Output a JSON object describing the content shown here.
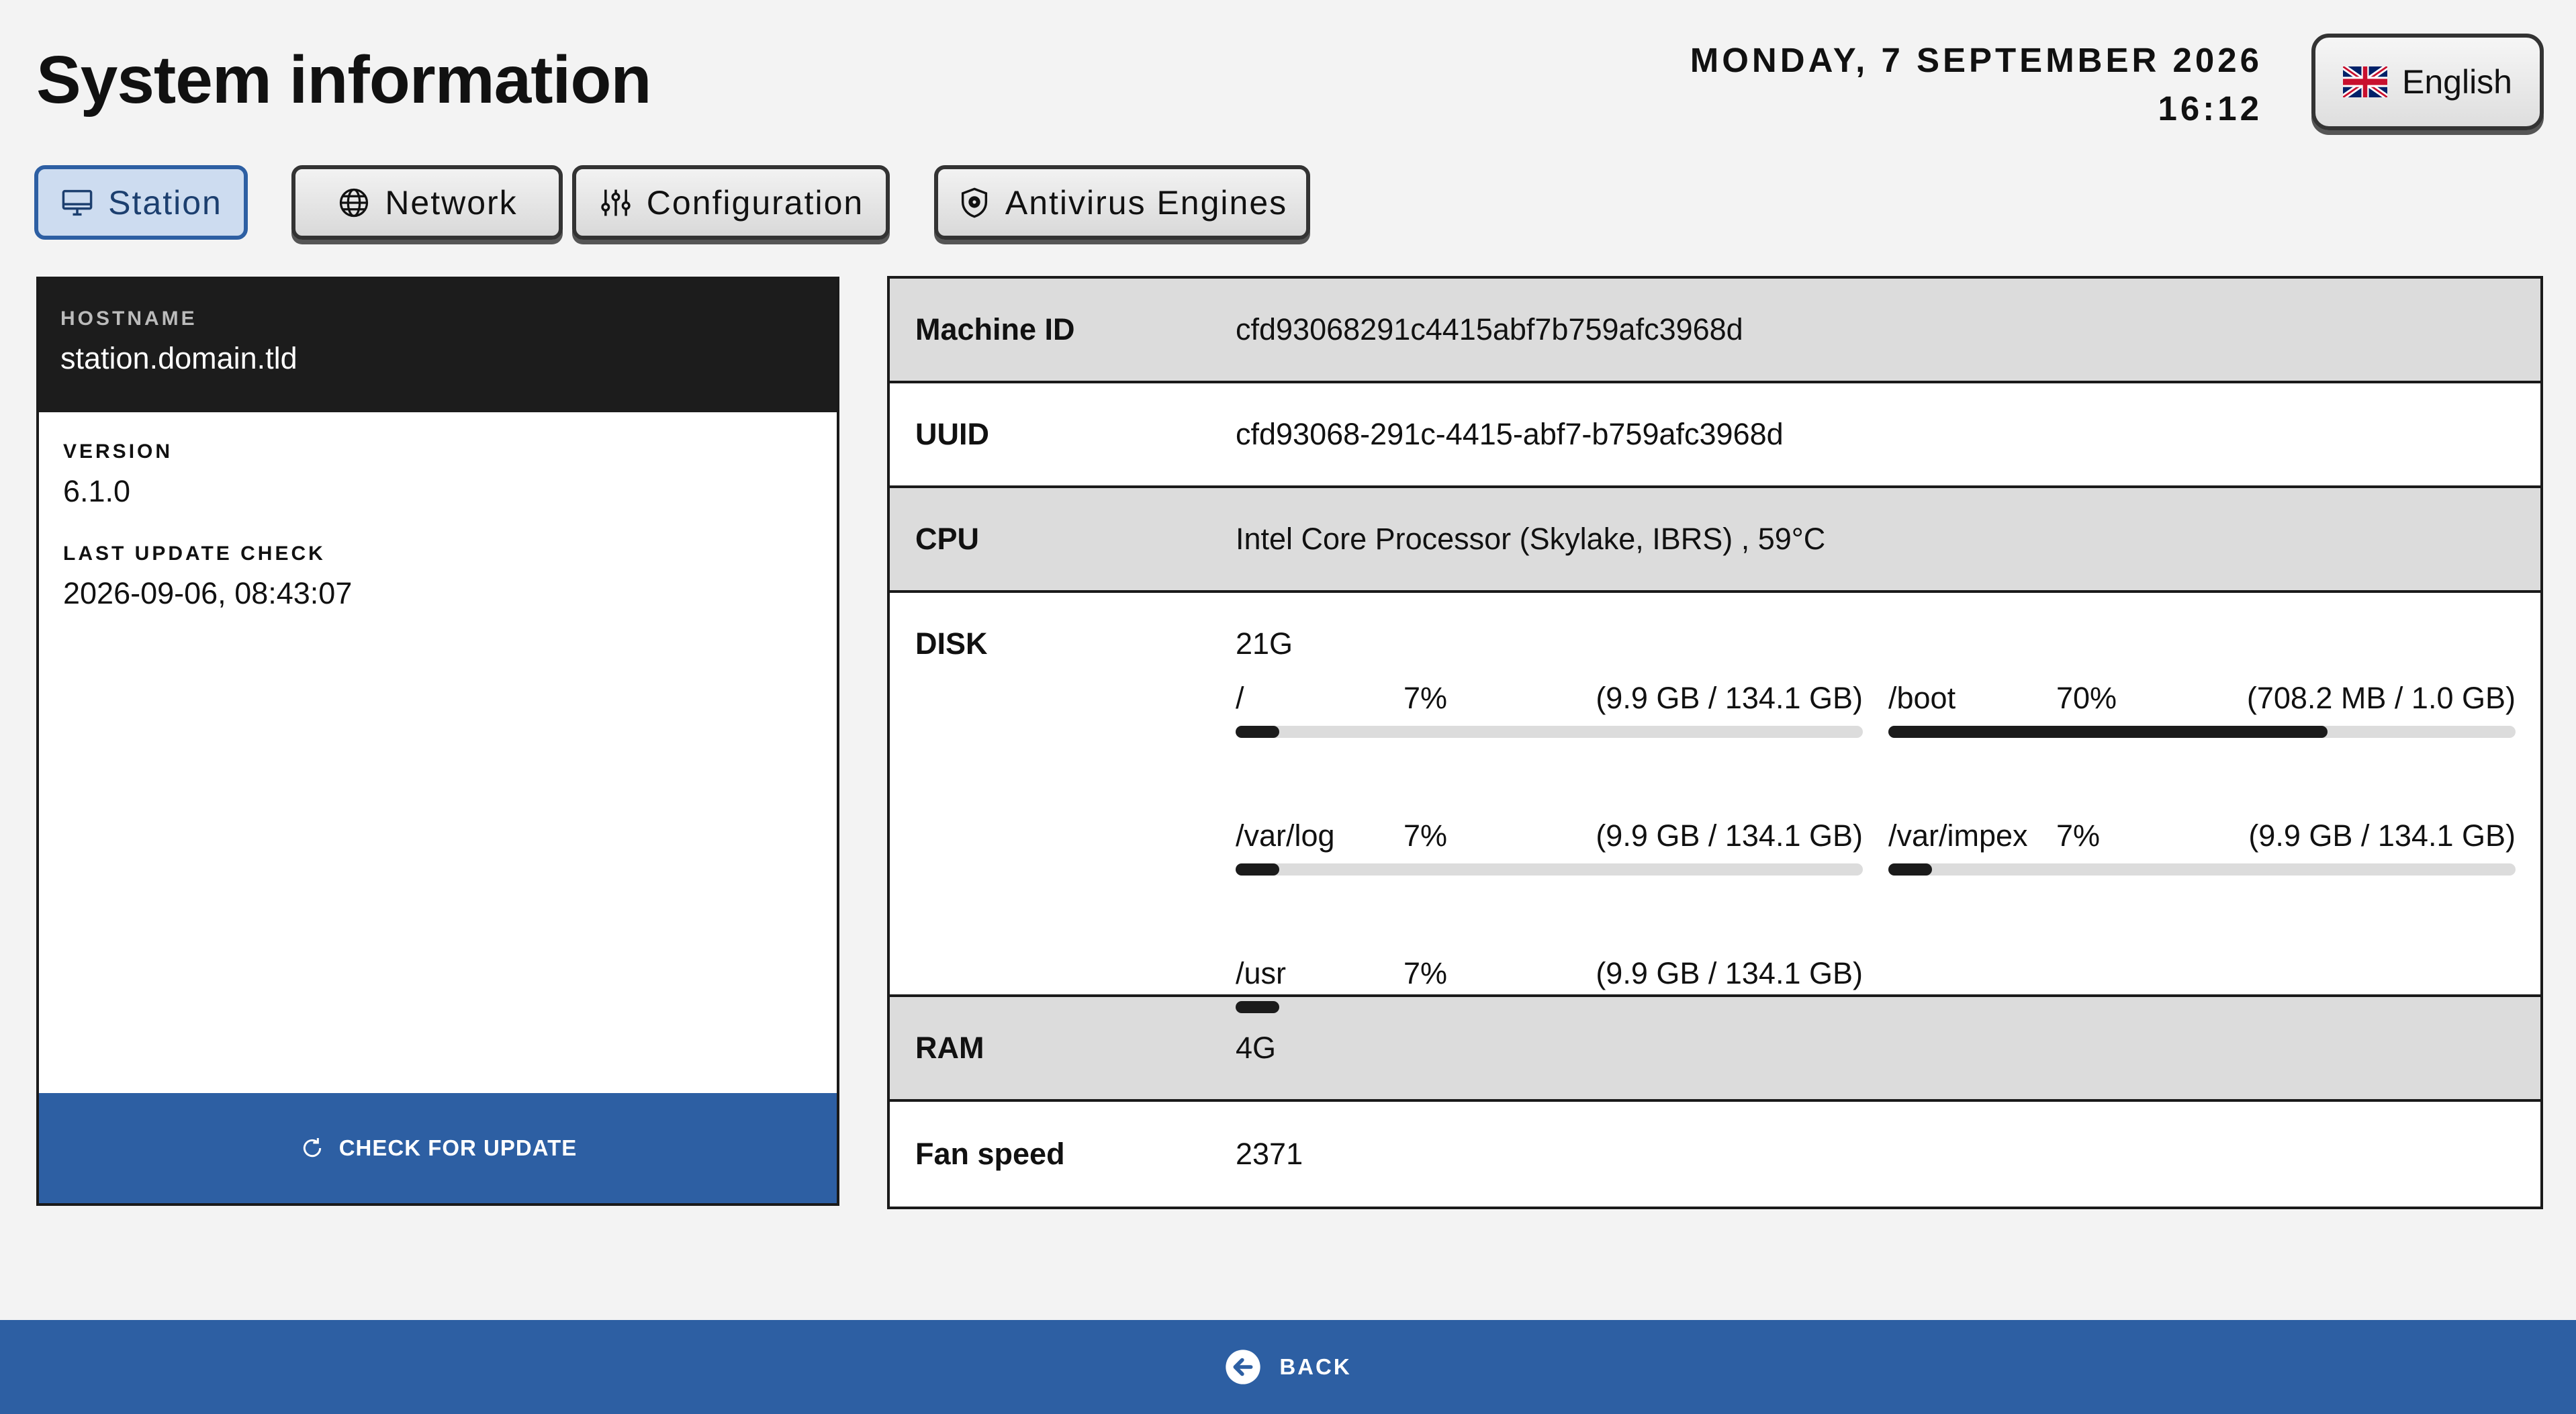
{
  "header": {
    "title": "System information",
    "date": "MONDAY, 7 SEPTEMBER 2026",
    "time": "16:12",
    "language": {
      "label": "English",
      "flag_icon": "uk-flag-icon"
    }
  },
  "tabs": [
    {
      "label": "Station",
      "icon": "monitor-icon",
      "active": true
    },
    {
      "label": "Network",
      "icon": "globe-icon",
      "active": false
    },
    {
      "label": "Configuration",
      "icon": "sliders-icon",
      "active": false
    },
    {
      "label": "Antivirus Engines",
      "icon": "shield-gear-icon",
      "active": false
    }
  ],
  "station": {
    "hostname_label": "HOSTNAME",
    "hostname": "station.domain.tld",
    "version_label": "VERSION",
    "version": "6.1.0",
    "last_update_label": "LAST UPDATE CHECK",
    "last_update": "2026-09-06, 08:43:07",
    "check_button": "CHECK FOR UPDATE"
  },
  "details": {
    "machine_id": {
      "label": "Machine ID",
      "value": "cfd93068291c4415abf7b759afc3968d"
    },
    "uuid": {
      "label": "UUID",
      "value": "cfd93068-291c-4415-abf7-b759afc3968d"
    },
    "cpu": {
      "label": "CPU",
      "value": "Intel Core Processor (Skylake, IBRS) , 59°C"
    },
    "disk": {
      "label": "DISK",
      "total": "21G",
      "partitions": [
        {
          "mount": "/",
          "percent_label": "7%",
          "percent": 7,
          "size": "(9.9 GB / 134.1 GB)"
        },
        {
          "mount": "/boot",
          "percent_label": "70%",
          "percent": 70,
          "size": "(708.2 MB / 1.0 GB)"
        },
        {
          "mount": "/var/log",
          "percent_label": "7%",
          "percent": 7,
          "size": "(9.9 GB / 134.1 GB)"
        },
        {
          "mount": "/var/impex",
          "percent_label": "7%",
          "percent": 7,
          "size": "(9.9 GB / 134.1 GB)"
        },
        {
          "mount": "/usr",
          "percent_label": "7%",
          "percent": 7,
          "size": "(9.9 GB / 134.1 GB)"
        }
      ]
    },
    "ram": {
      "label": "RAM",
      "value": "4G"
    },
    "fan": {
      "label": "Fan speed",
      "value": "2371"
    }
  },
  "footer": {
    "back_label": "BACK"
  },
  "colors": {
    "accent": "#2d5fa3",
    "active_tab_bg": "#cddcf0",
    "row_shade": "#dcdcdc",
    "bar_fill": "#1b1b1b"
  }
}
